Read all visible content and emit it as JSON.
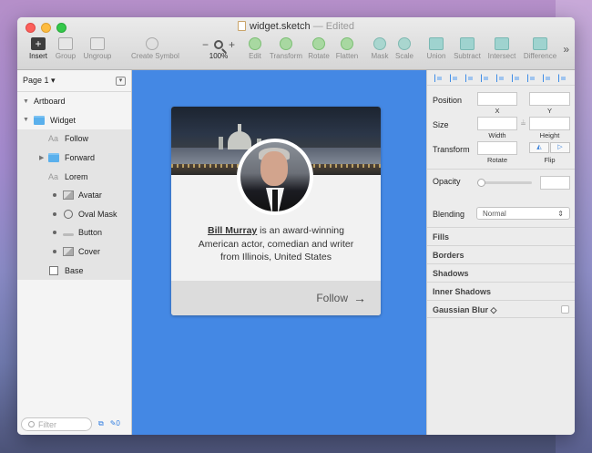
{
  "window": {
    "title": "widget.sketch",
    "status": "— Edited"
  },
  "toolbar": {
    "items": [
      {
        "label": "Insert",
        "icon": "plus-icon"
      },
      {
        "label": "Group",
        "icon": "group-icon"
      },
      {
        "label": "Ungroup",
        "icon": "ungroup-icon"
      },
      {
        "label": "Create Symbol",
        "icon": "symbol-icon"
      },
      {
        "label": "Edit",
        "icon": "edit-icon"
      },
      {
        "label": "Transform",
        "icon": "transform-icon"
      },
      {
        "label": "Rotate",
        "icon": "rotate-icon"
      },
      {
        "label": "Flatten",
        "icon": "flatten-icon"
      },
      {
        "label": "Mask",
        "icon": "mask-icon"
      },
      {
        "label": "Scale",
        "icon": "scale-icon"
      },
      {
        "label": "Union",
        "icon": "union-icon"
      },
      {
        "label": "Subtract",
        "icon": "subtract-icon"
      },
      {
        "label": "Intersect",
        "icon": "intersect-icon"
      },
      {
        "label": "Difference",
        "icon": "difference-icon"
      }
    ],
    "zoom": {
      "minus": "−",
      "plus": "+",
      "value": "100%"
    },
    "more": "»"
  },
  "layers": {
    "page": "Page 1",
    "items": [
      {
        "label": "Artboard"
      },
      {
        "label": "Widget"
      },
      {
        "label": "Follow"
      },
      {
        "label": "Forward"
      },
      {
        "label": "Lorem"
      },
      {
        "label": "Avatar"
      },
      {
        "label": "Oval Mask"
      },
      {
        "label": "Button"
      },
      {
        "label": "Cover"
      },
      {
        "label": "Base"
      }
    ],
    "filter_placeholder": "Filter",
    "page_count": "0"
  },
  "widget": {
    "name": "Bill Murray",
    "bio": " is an award-winning\nAmerican actor, comedian and writer\nfrom Illinois, United States",
    "follow": "Follow",
    "arrow": "→"
  },
  "inspector": {
    "position": "Position",
    "x": "X",
    "y": "Y",
    "size": "Size",
    "width": "Width",
    "height": "Height",
    "transform": "Transform",
    "rotate": "Rotate",
    "flip": "Flip",
    "opacity": "Opacity",
    "blending": "Blending",
    "blending_value": "Normal",
    "sections": [
      "Fills",
      "Borders",
      "Shadows",
      "Inner Shadows",
      "Gaussian Blur ◇"
    ]
  }
}
